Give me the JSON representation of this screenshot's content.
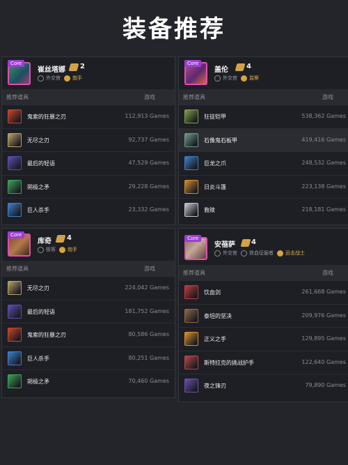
{
  "page_title": "装备推荐",
  "core_label": "Core",
  "items_header": "推荐道具",
  "games_header": "游戏",
  "cards": [
    {
      "name": "崔丝塔娜",
      "cost": "2",
      "traits": [
        {
          "label": "外交官",
          "icon": "trait-diplomat-icon",
          "style": "grey"
        },
        {
          "label": "炮手",
          "icon": "trait-gunner-icon",
          "style": "gold"
        }
      ],
      "rows": [
        {
          "name": "鬼索的狂暴之刃",
          "games": "112,913 Games",
          "icon": "guinsoos-rageblade-icon",
          "color": "#c9462a"
        },
        {
          "name": "无尽之刃",
          "games": "92,737 Games",
          "icon": "infinity-edge-icon",
          "color": "#b9a36a"
        },
        {
          "name": "最后的轻语",
          "games": "47,529 Games",
          "icon": "last-whisper-icon",
          "color": "#5b4fb3"
        },
        {
          "name": "朔极之矛",
          "games": "29,228 Games",
          "icon": "spear-of-shojin-icon",
          "color": "#3fa35a"
        },
        {
          "name": "巨人杀手",
          "games": "23,332 Games",
          "icon": "giant-slayer-icon",
          "color": "#3d7fd0"
        }
      ]
    },
    {
      "name": "盖伦",
      "cost": "4",
      "traits": [
        {
          "label": "外交官",
          "icon": "trait-diplomat-icon",
          "style": "grey"
        },
        {
          "label": "监察",
          "icon": "trait-warden-icon",
          "style": "gold"
        }
      ],
      "rows": [
        {
          "name": "狂徒铠甲",
          "games": "538,362 Games",
          "icon": "warmogs-armor-icon",
          "color": "#7fa04a"
        },
        {
          "name": "石像鬼石板甲",
          "games": "419,416 Games",
          "icon": "gargoyle-stoneplate-icon",
          "color": "#6f9a8a"
        },
        {
          "name": "巨龙之爪",
          "games": "248,532 Games",
          "icon": "dragons-claw-icon",
          "color": "#3f7fc6"
        },
        {
          "name": "日炎斗篷",
          "games": "223,138 Games",
          "icon": "sunfire-cape-icon",
          "color": "#d58a2f"
        },
        {
          "name": "救赎",
          "games": "218,181 Games",
          "icon": "redemption-icon",
          "color": "#c7c7d3"
        }
      ]
    },
    {
      "name": "库奇",
      "cost": "4",
      "traits": [
        {
          "label": "极客",
          "icon": "trait-geek-icon",
          "style": "grey"
        },
        {
          "label": "炮手",
          "icon": "trait-gunner-icon",
          "style": "gold"
        }
      ],
      "rows": [
        {
          "name": "无尽之刃",
          "games": "224,042 Games",
          "icon": "infinity-edge-icon",
          "color": "#b9a36a"
        },
        {
          "name": "最后的轻语",
          "games": "181,752 Games",
          "icon": "last-whisper-icon",
          "color": "#5b4fb3"
        },
        {
          "name": "鬼索的狂暴之刃",
          "games": "80,586 Games",
          "icon": "guinsoos-rageblade-icon",
          "color": "#c9462a"
        },
        {
          "name": "巨人杀手",
          "games": "80,251 Games",
          "icon": "giant-slayer-icon",
          "color": "#3d7fd0"
        },
        {
          "name": "朔极之矛",
          "games": "70,460 Games",
          "icon": "spear-of-shojin-icon",
          "color": "#3fa35a"
        }
      ]
    },
    {
      "name": "安蓓萨",
      "cost": "4",
      "traits": [
        {
          "label": "外交官",
          "icon": "trait-diplomat-icon",
          "style": "grey"
        },
        {
          "label": "铁血征服者",
          "icon": "trait-conqueror-icon",
          "style": "grey"
        },
        {
          "label": "迅击战士",
          "icon": "trait-challenger-icon",
          "style": "gold"
        }
      ],
      "rows": [
        {
          "name": "饮血剑",
          "games": "261,668 Games",
          "icon": "bloodthirster-icon",
          "color": "#c23a3a"
        },
        {
          "name": "泰坦的坚决",
          "games": "209,976 Games",
          "icon": "titans-resolve-icon",
          "color": "#8b6a4a"
        },
        {
          "name": "正义之手",
          "games": "129,895 Games",
          "icon": "hand-of-justice-icon",
          "color": "#d8902a"
        },
        {
          "name": "斯特拉克的挑战护手",
          "games": "122,640 Games",
          "icon": "steraks-gage-icon",
          "color": "#b8454a"
        },
        {
          "name": "夜之锋刃",
          "games": "79,890 Games",
          "icon": "edge-of-night-icon",
          "color": "#6b4fb0"
        }
      ]
    }
  ]
}
